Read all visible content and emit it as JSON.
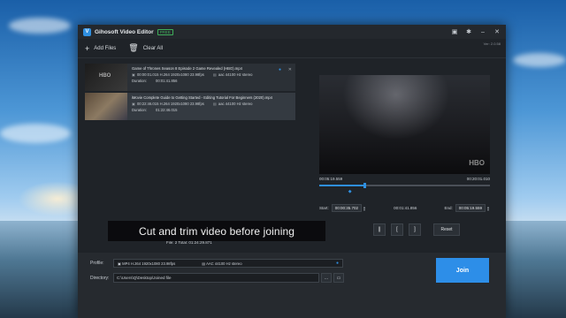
{
  "app": {
    "title": "Gihosoft Video Editor",
    "badge": "FREE",
    "version": "Ver: 2.0.58"
  },
  "toolbar": {
    "add_files": "Add Files",
    "clear_all": "Clear All"
  },
  "files": [
    {
      "name": "Game of Thrones Season 8 Episode 2 Game Revealed (HBO).mp4",
      "start": "00:00:01.015",
      "video": "H.264 1920x1080 23.98fps",
      "audio": "aac 44100 Hz stereo",
      "duration_label": "Duration:",
      "duration": "00:01:41.856",
      "thumb_text": "HBO"
    },
    {
      "name": "iMovie Complete Guide to Getting Started - Editing Tutorial For Beginners (2020).mp4",
      "start": "00:22:46.015",
      "video": "H.264 1920x1080 23.98fps",
      "audio": "aac 44100 Hz stereo",
      "duration_label": "Duration:",
      "duration": "01:22:46.015"
    }
  ],
  "preview": {
    "watermark": "HBO",
    "time_left": "00:05:19.559",
    "time_right": "00:20:01.010",
    "progress": 0.26
  },
  "trim": {
    "start_label": "Start:",
    "start_value": "00:00:35.702",
    "duration_value": "00:01:41.856",
    "end_label": "End:",
    "end_value": "00:05:19.559"
  },
  "controls": {
    "pause": "||",
    "mark_in": "[",
    "mark_out": "]",
    "reset": "Reset"
  },
  "summary": "File: 2   Total: 01:24:29.871",
  "caption": "Cut and trim video before joining",
  "output": {
    "profile_label": "Profile:",
    "profile_video": "MP4 H.264 1920x1080 23.98fps",
    "profile_audio": "AAC 44100 Hz stereo",
    "directory_label": "Directory:",
    "directory_value": "C:\\Users\\Q\\Desktop\\Joined file",
    "browse": "...",
    "join": "Join"
  }
}
